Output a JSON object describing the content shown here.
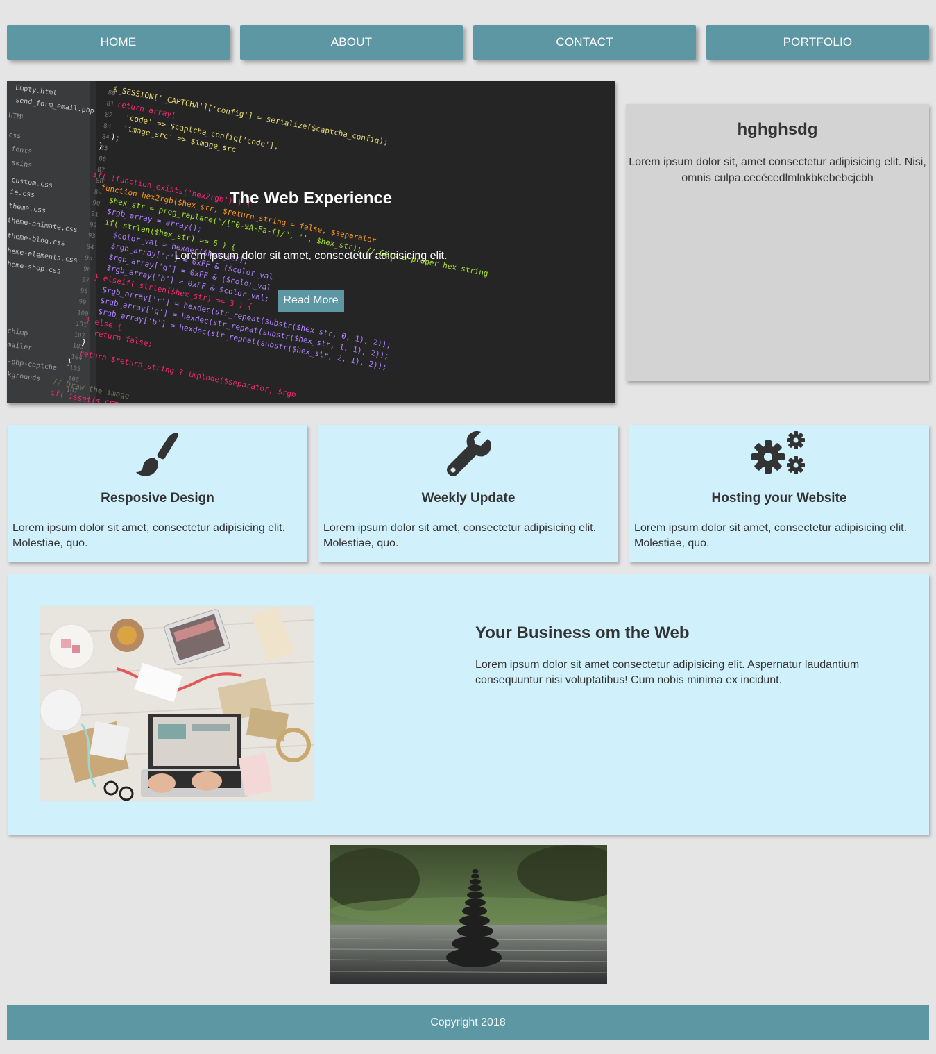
{
  "nav": {
    "items": [
      {
        "label": "HOME"
      },
      {
        "label": "ABOUT"
      },
      {
        "label": "CONTACT"
      },
      {
        "label": "PORTFOLIO"
      }
    ]
  },
  "hero": {
    "title": "The Web Experience",
    "text": "Lorem ipsum dolor sit amet, consectetur adipisicing elit.",
    "button_label": "Read More"
  },
  "side": {
    "title": "hghghsdg",
    "text": "Lorem ipsum dolor sit, amet consectetur adipisicing elit. Nisi, omnis culpa.cecécedlmlnkbkebebcjcbh"
  },
  "features": [
    {
      "icon": "paintbrush-icon",
      "title": "Resposive Design",
      "text": "Lorem ipsum dolor sit amet, consectetur adipisicing elit. Molestiae, quo."
    },
    {
      "icon": "wrench-icon",
      "title": "Weekly Update",
      "text": "Lorem ipsum dolor sit amet, consectetur adipisicing elit. Molestiae, quo."
    },
    {
      "icon": "cogs-icon",
      "title": "Hosting your Website",
      "text": "Lorem ipsum dolor sit amet, consectetur adipisicing elit. Molestiae, quo."
    }
  ],
  "business": {
    "title": "Your Business om the Web",
    "text": "Lorem ipsum dolor sit amet consectetur adipisicing elit. Aspernatur laudantium consequuntur nisi voluptatibus! Cum nobis minima ex incidunt."
  },
  "footer": {
    "copyright": "Copyright 2018"
  },
  "colors": {
    "accent": "#5d97a4",
    "page_bg": "#e5e5e5",
    "card_bg": "#d0f0fc",
    "side_bg": "#d3d3d3"
  }
}
